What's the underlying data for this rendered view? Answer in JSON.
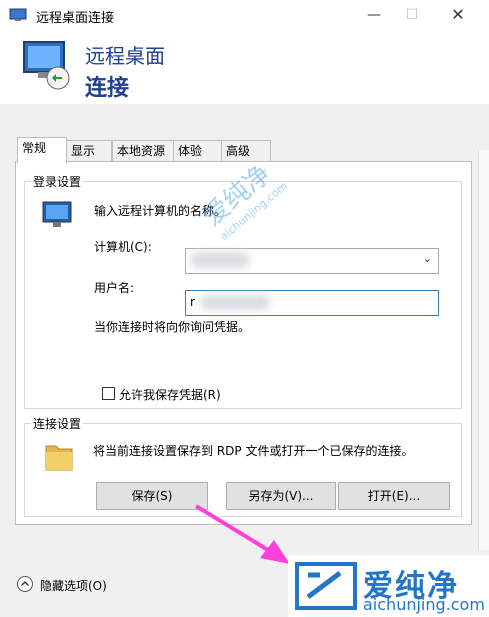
{
  "window": {
    "title": "远程桌面连接",
    "controls": {
      "minimize": "—",
      "maximize": "☐",
      "close": "✕"
    }
  },
  "banner": {
    "line1": "远程桌面",
    "line2": "连接"
  },
  "tabs": [
    "常规",
    "显示",
    "本地资源",
    "体验",
    "高级"
  ],
  "login": {
    "title": "登录设置",
    "prompt": "输入远程计算机的名称。",
    "computer_label": "计算机(C):",
    "user_label": "用户名:",
    "user_value": "r",
    "hint": "当你连接时将向你询问凭据。",
    "remember_label": "允许我保存凭据(R)"
  },
  "connection": {
    "title": "连接设置",
    "desc": "将当前连接设置保存到 RDP 文件或打开一个已保存的连接。",
    "save": "保存(S)",
    "save_as": "另存为(V)...",
    "open": "打开(E)..."
  },
  "footer": {
    "hide_options": "隐藏选项(O)"
  },
  "watermark": {
    "cn": "爱纯净",
    "url": "aichunjing.com"
  },
  "colors": {
    "accent": "#1f3f90",
    "watermark": "#2276c9",
    "arrow": "#ff3fd9"
  }
}
